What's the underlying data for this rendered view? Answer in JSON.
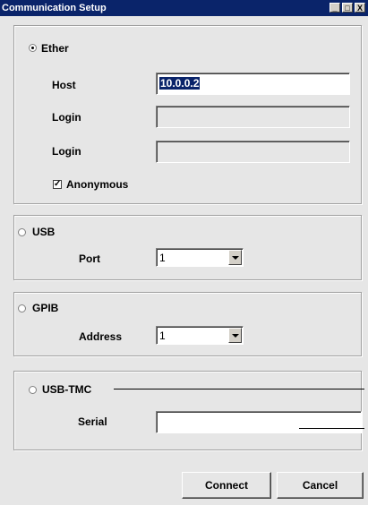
{
  "window": {
    "title": "Communication Setup",
    "controls": [
      "_",
      "□",
      "X"
    ]
  },
  "ether": {
    "radio_label": "Ether",
    "selected": true,
    "host_label": "Host",
    "host_value": "10.0.0.2",
    "login_label": "Login",
    "login_value": "",
    "password_label": "Login",
    "password_value": "",
    "anonymous_label": "Anonymous",
    "anonymous_checked": true,
    "check_mark": "✓"
  },
  "usb": {
    "radio_label": "USB",
    "selected": false,
    "port_label": "Port",
    "port_value": "1"
  },
  "gpib": {
    "radio_label": "GPIB",
    "selected": false,
    "address_label": "Address",
    "address_value": "1"
  },
  "usbtmc": {
    "radio_label": "USB-TMC",
    "selected": false,
    "serial_label": "Serial",
    "serial_value": ""
  },
  "buttons": {
    "connect": "Connect",
    "cancel": "Cancel"
  }
}
